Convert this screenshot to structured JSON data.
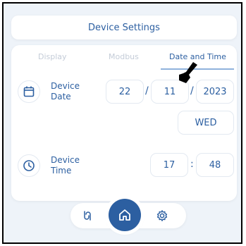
{
  "header": {
    "title": "Device Settings"
  },
  "tabs": [
    {
      "label": "Display"
    },
    {
      "label": "Modbus"
    },
    {
      "label": "Date and Time"
    }
  ],
  "date_row": {
    "label_line1": "Device",
    "label_line2": "Date",
    "icon": "calendar-icon",
    "day": "22",
    "separator": "/",
    "month": "11",
    "year": "2023",
    "weekday": "WED"
  },
  "time_row": {
    "label_line1": "Device",
    "label_line2": "Time",
    "icon": "clock-icon",
    "hour": "17",
    "separator": ":",
    "minute": "48"
  },
  "nav": {
    "left_icon": "plug-icon",
    "center_icon": "home-icon",
    "right_icon": "gear-icon"
  },
  "colors": {
    "accent": "#2c5fa1",
    "muted": "#c4ccd8",
    "background": "#eef3f9"
  }
}
